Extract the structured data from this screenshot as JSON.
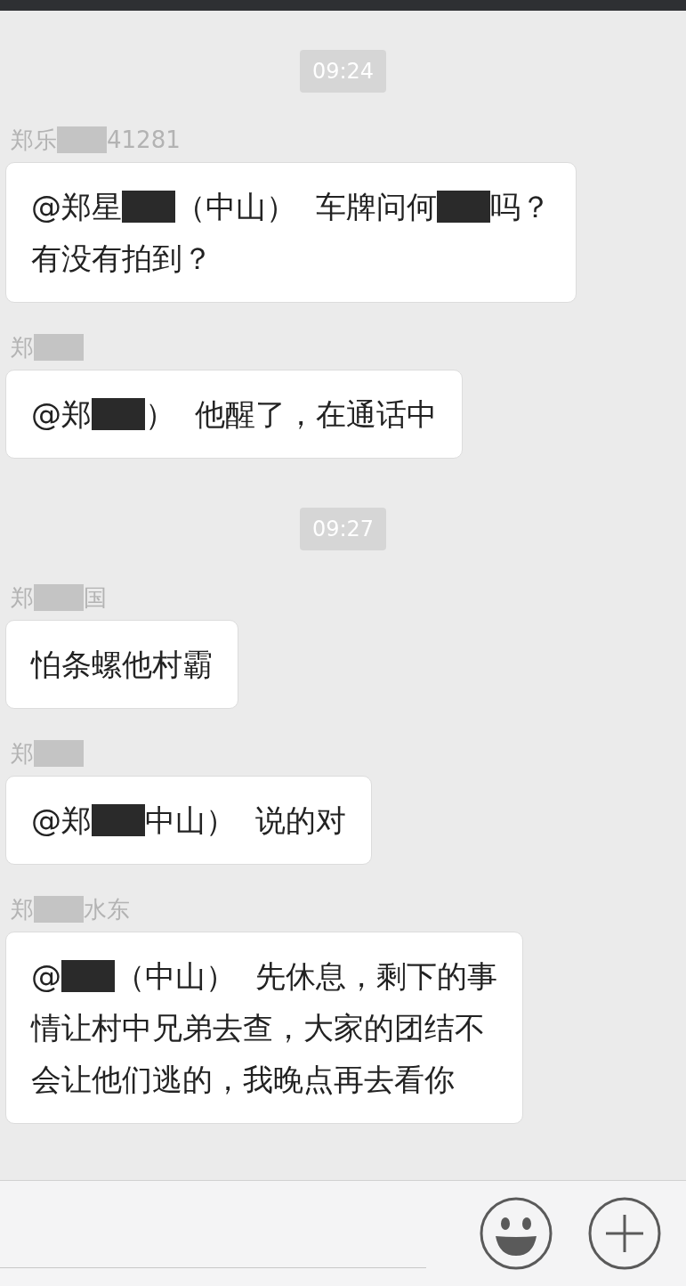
{
  "messages": [
    {
      "kind": "time",
      "text": "09:24"
    },
    {
      "kind": "message",
      "sender": [
        {
          "kind": "text",
          "text": "郑乐"
        },
        {
          "kind": "redacted"
        },
        {
          "kind": "text",
          "text": "41281"
        }
      ],
      "lines": [
        [
          {
            "kind": "text",
            "text": "@郑星"
          },
          {
            "kind": "redacted"
          },
          {
            "kind": "text",
            "text": "（中山）  车牌问何"
          },
          {
            "kind": "redacted"
          },
          {
            "kind": "text",
            "text": "吗？"
          }
        ],
        [
          {
            "kind": "text",
            "text": "有没有拍到？"
          }
        ]
      ]
    },
    {
      "kind": "message",
      "sender": [
        {
          "kind": "text",
          "text": "郑"
        },
        {
          "kind": "redacted"
        }
      ],
      "lines": [
        [
          {
            "kind": "text",
            "text": "@郑"
          },
          {
            "kind": "redacted"
          },
          {
            "kind": "text",
            "text": "）  他醒了，在通话中"
          }
        ]
      ]
    },
    {
      "kind": "time",
      "text": "09:27"
    },
    {
      "kind": "message",
      "sender": [
        {
          "kind": "text",
          "text": "郑"
        },
        {
          "kind": "redacted"
        },
        {
          "kind": "text",
          "text": "国"
        }
      ],
      "lines": [
        [
          {
            "kind": "text",
            "text": "怕条螺他村霸"
          }
        ]
      ]
    },
    {
      "kind": "message",
      "sender": [
        {
          "kind": "text",
          "text": "郑"
        },
        {
          "kind": "redacted"
        }
      ],
      "lines": [
        [
          {
            "kind": "text",
            "text": "@郑"
          },
          {
            "kind": "redacted"
          },
          {
            "kind": "text",
            "text": "中山）  说的对"
          }
        ]
      ]
    },
    {
      "kind": "message",
      "sender": [
        {
          "kind": "text",
          "text": "郑"
        },
        {
          "kind": "redacted"
        },
        {
          "kind": "text",
          "text": "水东"
        }
      ],
      "lines": [
        [
          {
            "kind": "text",
            "text": "@"
          },
          {
            "kind": "redacted"
          },
          {
            "kind": "text",
            "text": "（中山）  先休息，剩下的事"
          }
        ],
        [
          {
            "kind": "text",
            "text": "情让村中兄弟去查，大家的团结不"
          }
        ],
        [
          {
            "kind": "text",
            "text": "会让他们逃的，我晚点再去看你"
          }
        ]
      ]
    }
  ]
}
